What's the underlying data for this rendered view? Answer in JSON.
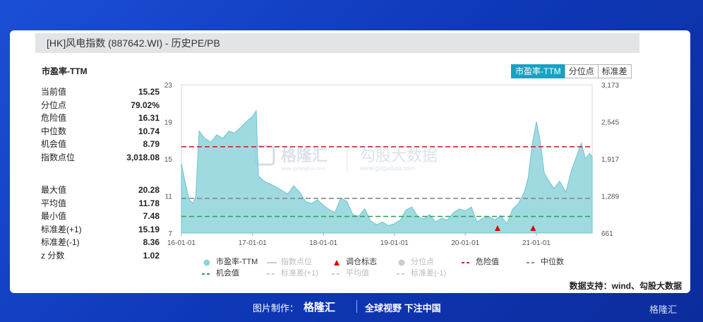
{
  "title": "[HK]风电指数 (887642.WI) - 历史PE/PB",
  "metric_title": "市盈率-TTM",
  "tabs": [
    {
      "label": "市盈率-TTM",
      "active": true
    },
    {
      "label": "分位点",
      "active": false
    },
    {
      "label": "标准差",
      "active": false
    }
  ],
  "stats_current": [
    {
      "label": "当前值",
      "value": "15.25"
    },
    {
      "label": "分位点",
      "value": "79.02%"
    },
    {
      "label": "危险值",
      "value": "16.31"
    },
    {
      "label": "中位数",
      "value": "10.74"
    },
    {
      "label": "机会值",
      "value": "8.79"
    },
    {
      "label": "指数点位",
      "value": "3,018.08"
    }
  ],
  "stats_summary": [
    {
      "label": "最大值",
      "value": "20.28"
    },
    {
      "label": "平均值",
      "value": "11.78"
    },
    {
      "label": "最小值",
      "value": "7.48"
    },
    {
      "label": "标准差(+1)",
      "value": "15.19"
    },
    {
      "label": "标准差(-1)",
      "value": "8.36"
    },
    {
      "label": "z 分数",
      "value": "1.02"
    }
  ],
  "watermark": {
    "brand": "格隆汇",
    "brand_url": "www.gelonghui.com",
    "partner": "勾股大数据",
    "partner_url": "www.gogudata.com"
  },
  "source": "数据支持：wind、勾股大数据",
  "footer": {
    "made_by": "图片制作：",
    "logo": "格隆汇",
    "slogan": "全球视野 下注中国",
    "corner": "格隆汇"
  },
  "colors": {
    "area": "#8fd3dc",
    "area_line": "#6cc3cf",
    "danger": "#c62828",
    "median": "#888888",
    "opportunity": "#2e9e4f",
    "accent": "#17a2c0"
  },
  "chart_data": {
    "type": "area",
    "title": "",
    "x_ticks": [
      "16-01-01",
      "17-01-01",
      "18-01-01",
      "19-01-01",
      "20-01-01",
      "21-01-01"
    ],
    "x_range": [
      "2016-01-01",
      "2021-10-15"
    ],
    "y_left": {
      "ticks": [
        "7",
        "11",
        "15",
        "19",
        "23"
      ],
      "range": [
        7,
        23
      ]
    },
    "y_right": {
      "ticks": [
        "661",
        "1,289",
        "1,917",
        "2,545",
        "3,173"
      ],
      "range": [
        661,
        3173
      ]
    },
    "series": [
      {
        "name": "市盈率-TTM",
        "points": [
          [
            "2016-01-01",
            14.5
          ],
          [
            "2016-01-20",
            12.5
          ],
          [
            "2016-02-10",
            10.6
          ],
          [
            "2016-03-01",
            10.2
          ],
          [
            "2016-03-15",
            11.0
          ],
          [
            "2016-04-01",
            18.0
          ],
          [
            "2016-05-01",
            17.2
          ],
          [
            "2016-06-01",
            16.8
          ],
          [
            "2016-07-01",
            17.6
          ],
          [
            "2016-08-01",
            17.2
          ],
          [
            "2016-09-01",
            18.0
          ],
          [
            "2016-10-01",
            17.8
          ],
          [
            "2016-11-01",
            18.4
          ],
          [
            "2016-11-20",
            18.8
          ],
          [
            "2016-12-15",
            19.3
          ],
          [
            "2017-01-01",
            19.6
          ],
          [
            "2017-01-20",
            20.2
          ],
          [
            "2017-01-31",
            13.2
          ],
          [
            "2017-03-01",
            12.6
          ],
          [
            "2017-04-01",
            12.3
          ],
          [
            "2017-05-01",
            12.0
          ],
          [
            "2017-06-01",
            11.6
          ],
          [
            "2017-07-01",
            11.2
          ],
          [
            "2017-08-01",
            12.1
          ],
          [
            "2017-09-01",
            11.4
          ],
          [
            "2017-10-01",
            10.4
          ],
          [
            "2017-11-01",
            10.2
          ],
          [
            "2017-12-01",
            10.6
          ],
          [
            "2018-01-01",
            10.0
          ],
          [
            "2018-02-01",
            9.5
          ],
          [
            "2018-03-01",
            9.2
          ],
          [
            "2018-04-01",
            10.8
          ],
          [
            "2018-05-01",
            10.4
          ],
          [
            "2018-06-01",
            9.0
          ],
          [
            "2018-07-01",
            8.8
          ],
          [
            "2018-08-01",
            9.6
          ],
          [
            "2018-09-01",
            8.3
          ],
          [
            "2018-10-01",
            7.9
          ],
          [
            "2018-11-01",
            8.2
          ],
          [
            "2018-12-01",
            7.8
          ],
          [
            "2019-01-01",
            8.0
          ],
          [
            "2019-02-01",
            8.4
          ],
          [
            "2019-03-01",
            9.5
          ],
          [
            "2019-04-01",
            9.8
          ],
          [
            "2019-05-01",
            8.8
          ],
          [
            "2019-06-01",
            8.5
          ],
          [
            "2019-07-01",
            9.0
          ],
          [
            "2019-08-01",
            8.2
          ],
          [
            "2019-09-01",
            8.6
          ],
          [
            "2019-10-01",
            8.4
          ],
          [
            "2019-11-01",
            9.2
          ],
          [
            "2019-12-01",
            9.6
          ],
          [
            "2020-01-01",
            9.4
          ],
          [
            "2020-02-01",
            9.8
          ],
          [
            "2020-03-01",
            8.2
          ],
          [
            "2020-04-01",
            8.6
          ],
          [
            "2020-05-01",
            8.8
          ],
          [
            "2020-06-01",
            8.4
          ],
          [
            "2020-07-01",
            8.9
          ],
          [
            "2020-08-01",
            8.0
          ],
          [
            "2020-09-01",
            9.6
          ],
          [
            "2020-10-01",
            10.2
          ],
          [
            "2020-11-01",
            11.5
          ],
          [
            "2020-11-20",
            13.0
          ],
          [
            "2020-12-10",
            16.5
          ],
          [
            "2021-01-01",
            19.0
          ],
          [
            "2021-01-20",
            17.0
          ],
          [
            "2021-02-10",
            13.5
          ],
          [
            "2021-03-01",
            12.8
          ],
          [
            "2021-04-01",
            11.8
          ],
          [
            "2021-05-01",
            12.6
          ],
          [
            "2021-06-01",
            11.4
          ],
          [
            "2021-07-01",
            13.8
          ],
          [
            "2021-08-01",
            15.6
          ],
          [
            "2021-08-20",
            16.7
          ],
          [
            "2021-09-10",
            15.0
          ],
          [
            "2021-10-01",
            15.6
          ],
          [
            "2021-10-15",
            15.25
          ]
        ]
      }
    ],
    "reference_lines": [
      {
        "name": "危险值",
        "value": 16.31,
        "style": "dashed",
        "color": "#c62828"
      },
      {
        "name": "中位数",
        "value": 10.74,
        "style": "dashed",
        "color": "#888888"
      },
      {
        "name": "机会值",
        "value": 8.79,
        "style": "dashed",
        "color": "#2e9e4f"
      }
    ],
    "markers": {
      "name": "调仓标志",
      "dates": [
        "2020-06-15",
        "2020-12-15"
      ]
    },
    "legend": [
      {
        "label": "市盈率-TTM",
        "symbol": "dot",
        "color": "#8fd3dc",
        "active": true
      },
      {
        "label": "指数点位",
        "symbol": "line",
        "color": "#cccccc",
        "active": false
      },
      {
        "label": "调仓标志",
        "symbol": "triangle",
        "color": "#e00000",
        "active": true
      },
      {
        "label": "分位点",
        "symbol": "dot",
        "color": "#cccccc",
        "active": false
      },
      {
        "label": "危险值",
        "symbol": "dash",
        "color": "#c62828",
        "active": true
      },
      {
        "label": "中位数",
        "symbol": "dash",
        "color": "#888888",
        "active": true
      },
      {
        "label": "机会值",
        "symbol": "dash",
        "color": "#2e9e4f",
        "active": true
      },
      {
        "label": "标准差(+1)",
        "symbol": "dash",
        "color": "#cccccc",
        "active": false
      },
      {
        "label": "平均值",
        "symbol": "dash",
        "color": "#cccccc",
        "active": false
      },
      {
        "label": "标准差(-1)",
        "symbol": "dash",
        "color": "#cccccc",
        "active": false
      }
    ],
    "legend_position": "bottom",
    "grid": false
  }
}
